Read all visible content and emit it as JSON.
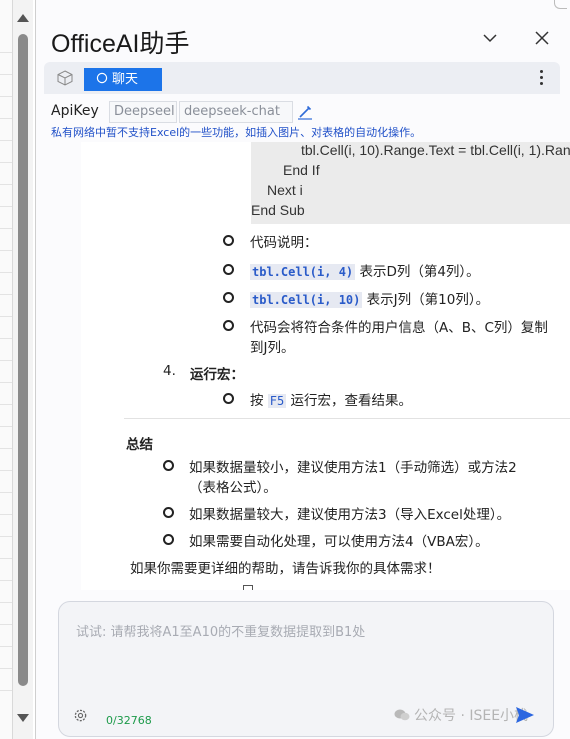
{
  "panel": {
    "title": "OfficeAI助手"
  },
  "tabbar": {
    "chat_label": "聊天"
  },
  "config": {
    "apikey_label": "ApiKey",
    "model_provider": "Deepseel",
    "model_name": "deepseek-chat",
    "notice": "私有网络中暂不支持Excel的一些功能，如插入图片、对表格的自动化操作。"
  },
  "content": {
    "code_lines": [
      "tbl.Cell(i, 10).Range.Text = tbl.Cell(i, 1).Ran",
      "End If",
      "Next i",
      "End Sub"
    ],
    "code_explain_label": "代码说明：",
    "bullets": [
      {
        "code": "tbl.Cell(i, 4)",
        "text": " 表示D列（第4列）。"
      },
      {
        "code": "tbl.Cell(i, 10)",
        "text": " 表示J列（第10列）。"
      }
    ],
    "copy_note_line1": "代码会将符合条件的用户信息（A、B、C列）复制",
    "copy_note_line2": "到J列。",
    "step4_num": "4.",
    "step4_label": "运行宏",
    "step4_colon": "：",
    "run_pre": "按 ",
    "run_key": "F5",
    "run_post": " 运行宏，查看结果。",
    "summary_title": "总结",
    "summary_items": [
      "如果数据量较小，建议使用方法1（手动筛选）或方法2",
      "（表格公式）。",
      "如果数据量较大，建议使用方法3（导入Excel处理）。",
      "如果需要自动化处理，可以使用方法4（VBA宏）。"
    ],
    "closing": "如果你需要更详细的帮助，请告诉我你的具体需求！"
  },
  "input": {
    "placeholder": "试试: 请帮我将A1至A10的不重复数据提取到B1处",
    "counter": "0/32768",
    "watermark": "公众号 · ISEE小栈"
  },
  "colors": {
    "accent": "#1c74e9",
    "notice": "#2050c8",
    "counter": "#1d9a4a"
  }
}
